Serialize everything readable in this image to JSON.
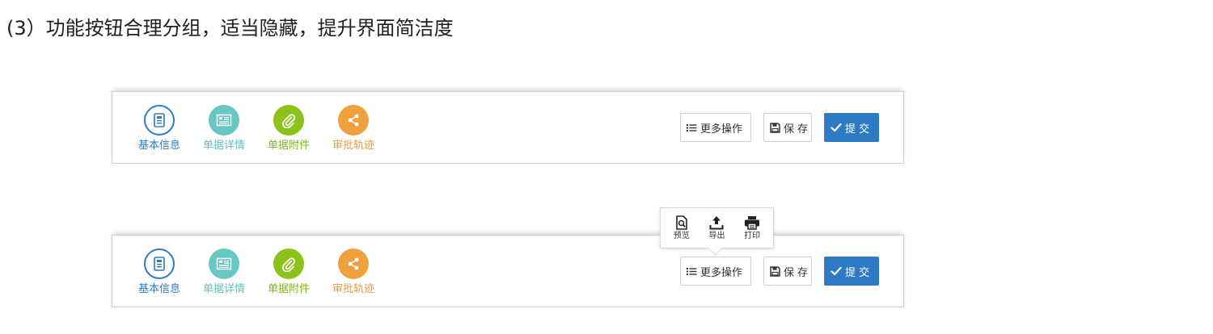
{
  "heading": "(3）功能按钮合理分组，适当隐藏，提升界面简洁度",
  "colors": {
    "blue": "#2e7bc4",
    "teal": "#66c7c3",
    "green": "#8cc21a",
    "orange": "#f0a03c",
    "submit_bg": "#2e7bc4"
  },
  "nav_items": [
    {
      "label": "基本信息",
      "icon": "document-icon"
    },
    {
      "label": "单据详情",
      "icon": "list-detail-icon"
    },
    {
      "label": "单据附件",
      "icon": "paperclip-icon"
    },
    {
      "label": "审批轨迹",
      "icon": "share-icon"
    }
  ],
  "actions": {
    "more": "更多操作",
    "save": "保 存",
    "submit": "提 交"
  },
  "more_menu": [
    {
      "label": "预览",
      "icon": "preview-icon"
    },
    {
      "label": "导出",
      "icon": "export-icon"
    },
    {
      "label": "打印",
      "icon": "print-icon"
    }
  ]
}
